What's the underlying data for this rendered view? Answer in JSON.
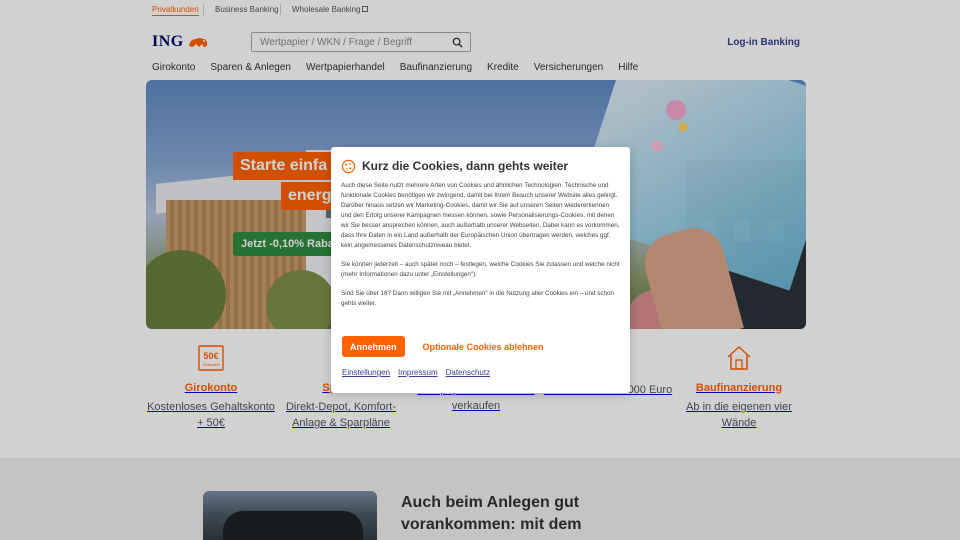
{
  "topbar": {
    "items": [
      {
        "label": "Privatkunden",
        "active": true
      },
      {
        "label": "Business Banking",
        "active": false
      },
      {
        "label": "Wholesale Banking",
        "active": false,
        "icon": "external-link-icon"
      }
    ]
  },
  "header": {
    "logo_text": "ING",
    "search_placeholder": "Wertpapier / WKN / Frage / Begriff",
    "search_value": "",
    "login_label": "Log-in Banking"
  },
  "nav": {
    "items": [
      "Girokonto",
      "Sparen & Anlegen",
      "Wertpapierhandel",
      "Baufinanzierung",
      "Kredite",
      "Versicherungen",
      "Hilfe"
    ]
  },
  "hero": {
    "badge_line1": "Starte einfa",
    "badge_line2": "energ",
    "badge_green": "Jetzt -0,10% Raba"
  },
  "products": [
    {
      "icon": "voucher-50-icon",
      "icon_text": "50€",
      "icon_subtext": "Gutschrift",
      "title": "Girokonto",
      "desc": "Kostenloses Gehaltskonto + 50€"
    },
    {
      "icon": "",
      "title": "Sparen",
      "desc": "Direkt-Depot, Komfort-Anlage & Sparpläne"
    },
    {
      "icon": "",
      "title": "",
      "desc": "Wertpapiere kaufen und verkaufen"
    },
    {
      "icon": "",
      "title": "",
      "desc": "von 2.500 bis 75.000 Euro"
    },
    {
      "icon": "house-icon",
      "title": "Baufinanzierung",
      "desc": "Ab in die eigenen vier Wände"
    }
  ],
  "lower": {
    "headline": "Auch beim Anlegen gut vorankommen: mit dem"
  },
  "cookie": {
    "icon": "cookie-icon",
    "title": "Kurz die Cookies, dann gehts weiter",
    "paragraph1": "Auch diese Seite nutzt mehrere Arten von Cookies und ähnlichen Technologien. Technische und funktionale Cookies benötigen wir zwingend, damit bei Ihrem Besuch unserer Website alles gelingt. Darüber hinaus setzen wir Marketing-Cookies, damit wir Sie auf unseren Seiten wiedererkennen und den Erfolg unserer Kampagnen messen können, sowie Personalisierungs-Cookies, mit denen wir Sie besser ansprechen können, auch außerhalb unserer Webseiten. Dabei kann es vorkommen, dass Ihre Daten in ein Land außerhalb der Europäischen Union übertragen werden, welches ggf. kein angemessenes Datenschutzniveau bietet.",
    "paragraph2": "Sie können jederzeit – auch später noch – festlegen, welche Cookies Sie zulassen und welche nicht (mehr Informationen dazu unter „Einstellungen“).",
    "paragraph3": "Sind Sie über 16? Dann willigen Sie mit „Annehmen“ in die Nutzung aller Cookies ein – und schon gehts weiter.",
    "accept_label": "Annehmen",
    "decline_label": "Optionale Cookies ablehnen",
    "links": [
      "Einstellungen",
      "Impressum",
      "Datenschutz"
    ]
  },
  "colors": {
    "brand_orange": "#ff6200",
    "brand_blue": "#000066",
    "link_blue": "#3a3f8f",
    "badge_green": "#2e8b3e"
  }
}
